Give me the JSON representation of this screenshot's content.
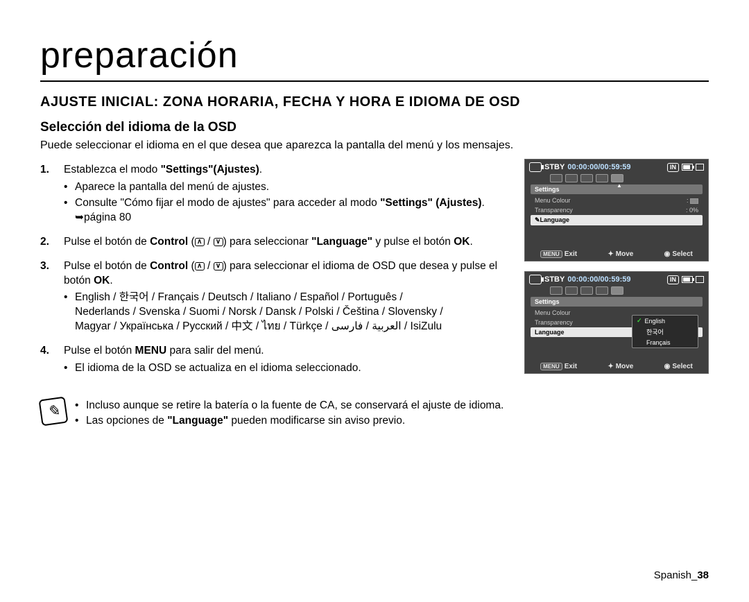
{
  "page_title": "preparación",
  "section_heading": "AJUSTE INICIAL: ZONA HORARIA, FECHA Y HORA E IDIOMA DE OSD",
  "subheading": "Selección del idioma de la OSD",
  "intro": "Puede seleccionar el idioma en el que desea que aparezca la pantalla del menú y los mensajes.",
  "steps": {
    "s1": {
      "text_a": "Establezca el modo ",
      "bold_a": "\"Settings\"(Ajustes)",
      "text_b": ".",
      "b1": "Aparece la pantalla del menú de ajustes.",
      "b2_a": "Consulte \"Cómo fijar el modo de ajustes\" para acceder al modo ",
      "b2_bold": "\"Settings\" (Ajustes)",
      "b2_b": ". ➥página 80"
    },
    "s2": {
      "text_a": "Pulse el botón de ",
      "bold_a": "Control",
      "text_b": " (",
      "text_c": " / ",
      "text_d": ") para seleccionar ",
      "bold_b": "\"Language\"",
      "text_e": " y pulse el botón ",
      "bold_c": "OK",
      "text_f": "."
    },
    "s3": {
      "text_a": "Pulse el botón de ",
      "bold_a": "Control",
      "text_b": " (",
      "text_c": " / ",
      "text_d": ") para seleccionar el idioma de OSD que desea y pulse el botón ",
      "bold_b": "OK",
      "text_e": ".",
      "langs_line1": "English / 한국어 / Français / Deutsch / Italiano / Español / Português /",
      "langs_line2": "Nederlands / Svenska / Suomi / Norsk / Dansk / Polski / Čeština / Slovensky / ",
      "langs_line3": "Magyar / Українська / Русский / 中文 / ไทย / Türkçe / العربية / فارسی / IsiZulu"
    },
    "s4": {
      "text_a": "Pulse el botón ",
      "bold_a": "MENU",
      "text_b": " para salir del menú.",
      "b1": "El idioma de la OSD se actualiza en el idioma seleccionado."
    }
  },
  "notes": {
    "n1": "Incluso aunque se retire la batería o la fuente de CA, se conservará el ajuste de idioma.",
    "n2_a": "Las opciones de ",
    "n2_bold": "\"Language\"",
    "n2_b": " pueden modificarse sin aviso previo."
  },
  "screen": {
    "stby": "STBY",
    "time": "00:00:00/00:59:59",
    "in": "IN",
    "settings": "Settings",
    "menu_colour": "Menu Colour",
    "transparency": "Transparency",
    "transparency_val": "0%",
    "language": "Language",
    "menu_badge": "MENU",
    "exit": "Exit",
    "move": "Move",
    "select": "Select",
    "opts": {
      "english": "English",
      "korean": "한국어",
      "french": "Français"
    }
  },
  "footer": {
    "label": "Spanish_",
    "page": "38"
  }
}
